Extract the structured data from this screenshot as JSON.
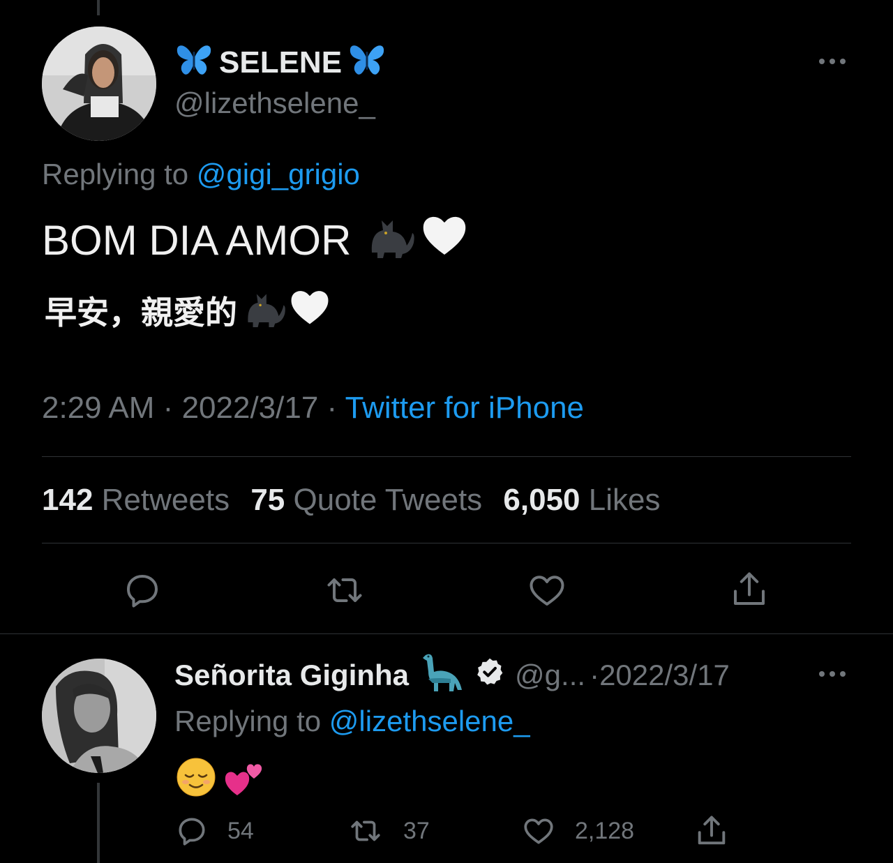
{
  "tweet": {
    "display_name": "SELENE",
    "handle": "@lizethselene_",
    "replying_prefix": "Replying to",
    "replying_handle": "@gigi_grigio",
    "line1": "BOM DIA AMOR",
    "line2": "早安，親愛的",
    "time": "2:29 AM",
    "sep1": "·",
    "date": "2022/3/17",
    "sep2": "·",
    "source": "Twitter for iPhone",
    "stats": {
      "retweets_count": "142",
      "retweets_label": "Retweets",
      "quotes_count": "75",
      "quotes_label": "Quote Tweets",
      "likes_count": "6,050",
      "likes_label": "Likes"
    }
  },
  "reply": {
    "display_name": "Señorita Giginha",
    "handle": "@g...",
    "sep": "·",
    "date": "2022/3/17",
    "replying_prefix": "Replying to",
    "replying_handle": "@lizethselene_",
    "replies_count": "54",
    "retweets_count": "37",
    "likes_count": "2,128"
  },
  "icons": [
    "butterfly-icon",
    "cat-emoji",
    "white-heart-emoji",
    "dinosaur-emoji",
    "verified-badge-icon",
    "relieved-face-emoji",
    "two-hearts-emoji",
    "reply-icon",
    "retweet-icon",
    "like-icon",
    "share-icon",
    "more-icon"
  ],
  "colors": {
    "background": "#000000",
    "text": "#e7e9ea",
    "muted": "#71767b",
    "link": "#1d9bf0",
    "divider": "#2f3336"
  }
}
